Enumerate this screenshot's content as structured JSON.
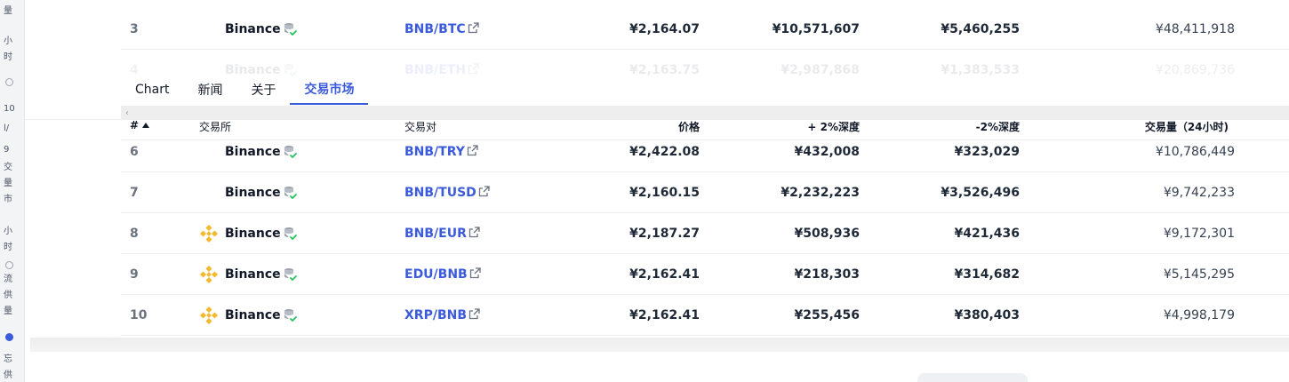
{
  "gutter_chars": [
    "量",
    "小",
    "时",
    "10",
    "l/",
    "9",
    "交",
    "量",
    "市",
    "小",
    "时",
    "流",
    "供",
    "量",
    "忘",
    "供"
  ],
  "tabs": [
    {
      "label": "Chart",
      "active": false
    },
    {
      "label": "新闻",
      "active": false
    },
    {
      "label": "关于",
      "active": false
    },
    {
      "label": "交易市场",
      "active": true
    }
  ],
  "scroll_left_glyph": "‹",
  "headers": {
    "rank": "#",
    "exchange": "交易所",
    "pair": "交易对",
    "price": "价格",
    "plus_depth": "+ 2%深度",
    "minus_depth": "-2%深度",
    "volume": "交易量（24小时)"
  },
  "rows": [
    {
      "rank": "3",
      "exchange": "Binance",
      "pair": "BNB/BTC",
      "price": "¥2,164.07",
      "plus_depth": "¥10,571,607",
      "minus_depth": "¥5,460,255",
      "volume": "¥48,411,918",
      "logo": false
    },
    {
      "rank": "4",
      "exchange": "Binance",
      "pair": "BNB/ETH",
      "price": "¥2,163.75",
      "plus_depth": "¥2,987,868",
      "minus_depth": "¥1,383,533",
      "volume": "¥20,869,736",
      "logo": false
    },
    {
      "rank": "6",
      "exchange": "Binance",
      "pair": "BNB/TRY",
      "price": "¥2,422.08",
      "plus_depth": "¥432,008",
      "minus_depth": "¥323,029",
      "volume": "¥10,786,449",
      "logo": false
    },
    {
      "rank": "7",
      "exchange": "Binance",
      "pair": "BNB/TUSD",
      "price": "¥2,160.15",
      "plus_depth": "¥2,232,223",
      "minus_depth": "¥3,526,496",
      "volume": "¥9,742,233",
      "logo": false
    },
    {
      "rank": "8",
      "exchange": "Binance",
      "pair": "BNB/EUR",
      "price": "¥2,187.27",
      "plus_depth": "¥508,936",
      "minus_depth": "¥421,436",
      "volume": "¥9,172,301",
      "logo": true
    },
    {
      "rank": "9",
      "exchange": "Binance",
      "pair": "EDU/BNB",
      "price": "¥2,162.41",
      "plus_depth": "¥218,303",
      "minus_depth": "¥314,682",
      "volume": "¥5,145,295",
      "logo": true
    },
    {
      "rank": "10",
      "exchange": "Binance",
      "pair": "XRP/BNB",
      "price": "¥2,162.41",
      "plus_depth": "¥255,456",
      "minus_depth": "¥380,403",
      "volume": "¥4,998,179",
      "logo": true
    }
  ],
  "colors": {
    "accent": "#3b5bdb",
    "binance_yellow": "#f3ba2f",
    "verified_green": "#22c55e"
  },
  "icons": {
    "exchange_verified": "database-check-icon",
    "external_link": "external-link-icon",
    "binance_logo": "binance-logo-icon",
    "sort": "sort-ascending-icon"
  }
}
